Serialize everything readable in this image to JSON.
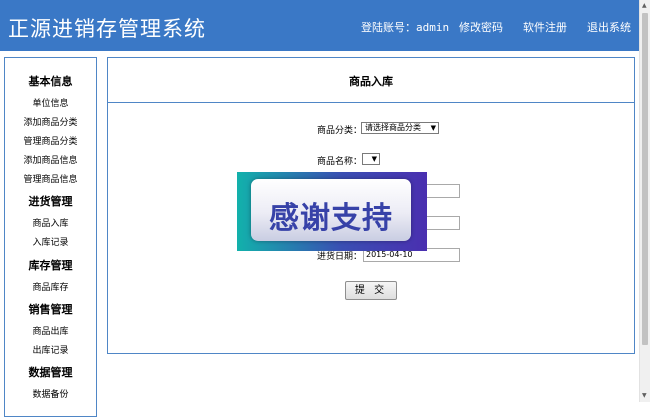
{
  "header": {
    "title": "正源进销存管理系统",
    "login_label": "登陆账号：",
    "login_user": "admin",
    "change_password": "修改密码",
    "register": "软件注册",
    "logout": "退出系统"
  },
  "sidebar": {
    "sections": [
      {
        "title": "基本信息",
        "items": [
          "单位信息",
          "添加商品分类",
          "管理商品分类",
          "添加商品信息",
          "管理商品信息"
        ]
      },
      {
        "title": "进货管理",
        "items": [
          "商品入库",
          "入库记录"
        ]
      },
      {
        "title": "库存管理",
        "items": [
          "商品库存"
        ]
      },
      {
        "title": "销售管理",
        "items": [
          "商品出库",
          "出库记录"
        ]
      },
      {
        "title": "数据管理",
        "items": [
          "数据备份"
        ]
      }
    ]
  },
  "main": {
    "title": "商品入库",
    "form": {
      "category_label": "商品分类：",
      "category_value": "请选择商品分类",
      "name_label": "商品名称：",
      "name_value": "",
      "date_label": "进货日期：",
      "date_value": "2015-04-10",
      "submit_label": "提 交"
    }
  },
  "overlay": {
    "text": "感谢支持"
  },
  "colors": {
    "header_bg": "#3a78c6",
    "panel_border": "#4f86c6",
    "overlay_text": "#3742a8"
  },
  "icons": {
    "dropdown": "triangle-down-icon",
    "scroll_up": "triangle-up-icon",
    "scroll_down": "triangle-down-icon"
  }
}
